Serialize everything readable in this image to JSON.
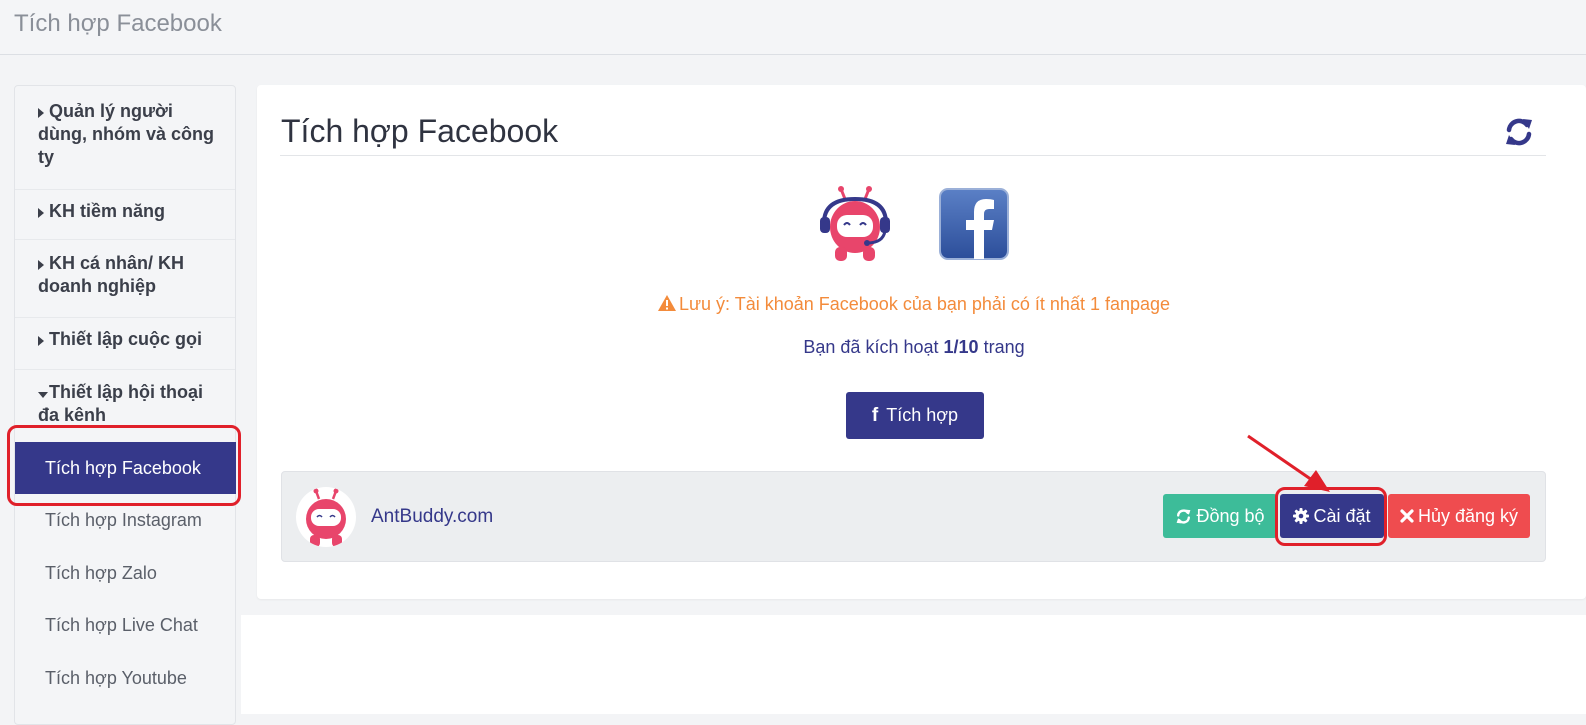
{
  "header": {
    "breadcrumb": "Tích hợp Facebook"
  },
  "sidebar": {
    "groups": [
      {
        "label": "Quản lý người dùng, nhóm và công ty"
      },
      {
        "label": "KH tiềm năng"
      },
      {
        "label": "KH cá nhân/ KH doanh nghiệp"
      },
      {
        "label": "Thiết lập cuộc gọi"
      },
      {
        "label": "Thiết lập hội thoại đa kênh"
      }
    ],
    "items": [
      {
        "label": "Tích hợp Facebook"
      },
      {
        "label": "Tích hợp Instagram"
      },
      {
        "label": "Tích hợp Zalo"
      },
      {
        "label": "Tích hợp Live Chat"
      },
      {
        "label": "Tích hợp Youtube"
      }
    ]
  },
  "main": {
    "title": "Tích hợp Facebook",
    "warning": "Lưu ý: Tài khoản Facebook của bạn phải có ít nhất 1 fanpage",
    "activated_prefix": "Bạn đã kích hoạt",
    "activated_count": "1/10",
    "activated_suffix": "trang",
    "integrate_button": "Tích hợp",
    "page_row": {
      "name": "AntBuddy.com",
      "sync_button": "Đồng bộ",
      "settings_button": "Cài đặt",
      "unsubscribe_button": "Hủy đăng ký"
    }
  },
  "colors": {
    "primary": "#35388a",
    "success": "#3dbc99",
    "danger": "#ef4c4f",
    "warning": "#f38b3b",
    "highlight": "#e0202a"
  },
  "icons": [
    "caret-right-icon",
    "caret-down-icon",
    "refresh-icon",
    "antbuddy-logo",
    "facebook-logo",
    "warning-icon",
    "facebook-f-icon",
    "sync-icon",
    "gear-icon",
    "close-icon",
    "arrow-annotation"
  ]
}
